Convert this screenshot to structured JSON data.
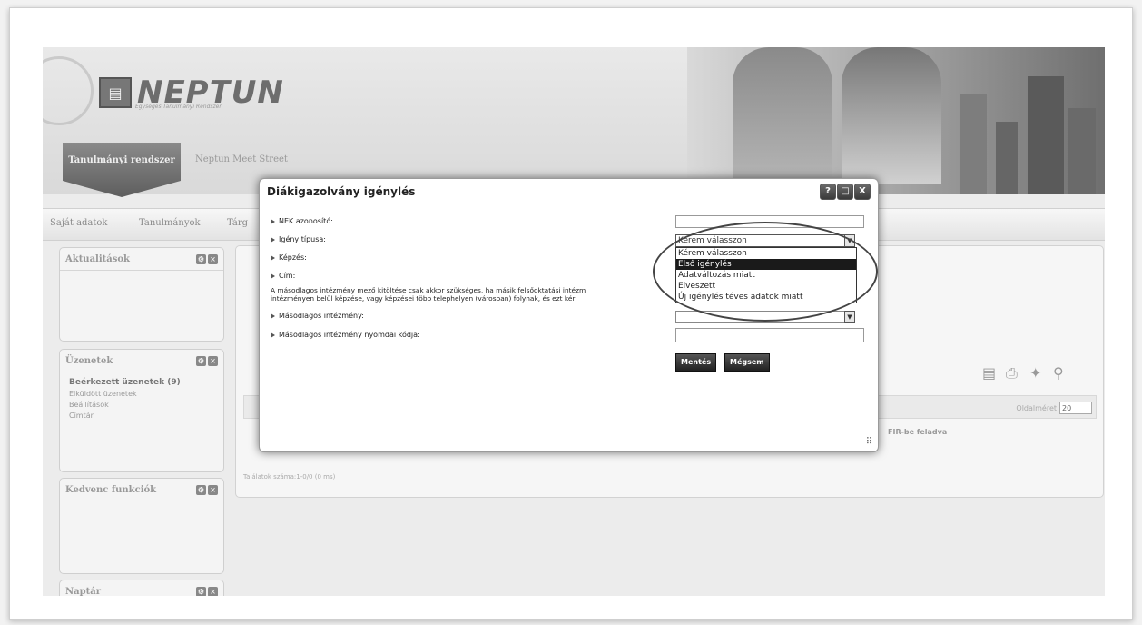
{
  "header": {
    "logo_text": "NEPTUN",
    "logo_subtitle": "Egységes Tanulmányi Rendszer",
    "tab_active": "Tanulmányi rendszer",
    "tab_other": "Neptun Meet Street"
  },
  "nav": {
    "items": [
      "Saját adatok",
      "Tanulmányok",
      "Tárg"
    ]
  },
  "sidebar": {
    "panels": [
      {
        "title": "Aktualitások"
      },
      {
        "title": "Üzenetek",
        "links": [
          "Beérkezett üzenetek (9)",
          "Elküldött üzenetek",
          "Beállítások",
          "Címtár"
        ]
      },
      {
        "title": "Kedvenc funkciók"
      },
      {
        "title": "Naptár"
      }
    ]
  },
  "content": {
    "page_size_label": "Oldalméret",
    "page_size_value": "20",
    "column_fir": "FIR-be feladva",
    "results_text": "Találatok száma:1-0/0 (0 ms)"
  },
  "modal": {
    "title": "Diákigazolvány igénylés",
    "ctrl_help": "?",
    "ctrl_max": "□",
    "ctrl_close": "X",
    "label_nek": "NEK azonosító:",
    "label_type": "Igény típusa:",
    "label_training": "Képzés:",
    "label_address": "Cím:",
    "note_line1": "A másodlagos intézmény mező kitöltése csak akkor szükséges, ha másik felsőoktatási intézm",
    "note_line2": "intézményen belül képzése, vagy képzései több telephelyen (városban) folynak, és ezt kéri",
    "label_secondary": "Másodlagos intézmény:",
    "label_secondary_code": "Másodlagos intézmény nyomdai kódja:",
    "type_selected": "Kérem válasszon",
    "type_options": [
      "Kérem válasszon",
      "Első igénylés",
      "Adatváltozás miatt",
      "Elveszett",
      "Új igénylés téves adatok miatt"
    ],
    "type_highlighted_index": 1,
    "save_label": "Mentés",
    "cancel_label": "Mégsem"
  }
}
